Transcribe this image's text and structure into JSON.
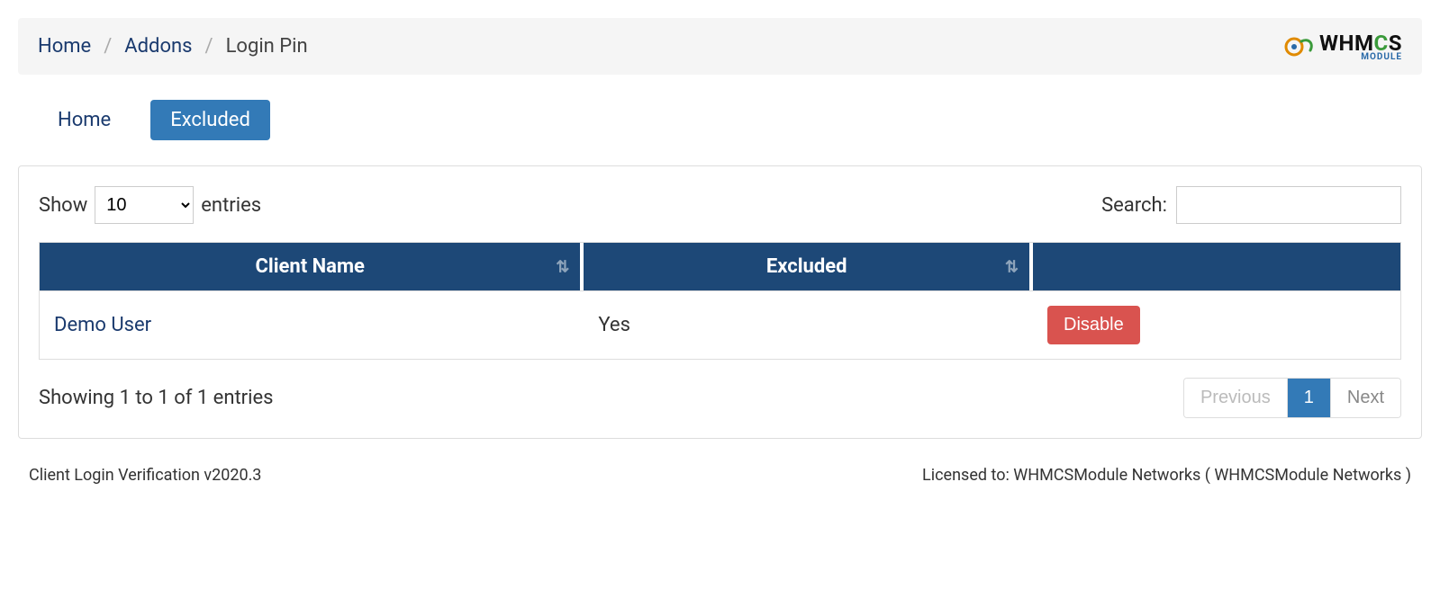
{
  "breadcrumb": {
    "home": "Home",
    "addons": "Addons",
    "current": "Login Pin"
  },
  "logo": {
    "text_part1": "WHM",
    "text_part2": "C",
    "text_part3": "S",
    "sub": "MODULE"
  },
  "tabs": {
    "home": "Home",
    "excluded": "Excluded"
  },
  "length": {
    "show": "Show",
    "entries": "entries",
    "options": [
      "10"
    ],
    "selected": "10"
  },
  "search": {
    "label": "Search:",
    "value": ""
  },
  "table": {
    "headers": {
      "client_name": "Client Name",
      "excluded": "Excluded",
      "actions": ""
    },
    "rows": [
      {
        "client_name": "Demo User",
        "excluded": "Yes",
        "action": "Disable"
      }
    ]
  },
  "info": "Showing 1 to 1 of 1 entries",
  "pagination": {
    "previous": "Previous",
    "pages": [
      "1"
    ],
    "next": "Next",
    "active": "1"
  },
  "footer": {
    "version": "Client Login Verification v2020.3",
    "license": "Licensed to: WHMCSModule Networks ( WHMCSModule Networks )"
  }
}
